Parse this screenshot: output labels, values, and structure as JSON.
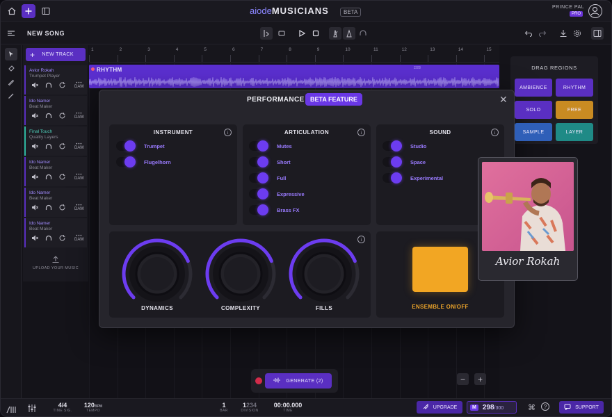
{
  "app": {
    "logo_mark": "aiode",
    "name": "MUSICIANS",
    "beta": "BETA"
  },
  "user": {
    "name": "PRINCE PAL",
    "plan": "PRO"
  },
  "song": {
    "title": "NEW SONG"
  },
  "tracks_panel": {
    "new_track_label": "NEW TRACK",
    "tracks": [
      {
        "name": "Avior Rokah",
        "role": "Trumpet Player"
      },
      {
        "name": "Ido Namer",
        "role": "Beat Maker"
      },
      {
        "name": "Final Touch",
        "role": "Quality Layers"
      },
      {
        "name": "Ido Namer",
        "role": "Beat Maker"
      },
      {
        "name": "Ido Namer",
        "role": "Beat Maker"
      },
      {
        "name": "Ido Namer",
        "role": "Beat Maker"
      }
    ],
    "daw_label": "DAW",
    "upload_label": "UPLOAD YOUR MUSIC"
  },
  "timeline": {
    "bars": [
      "1",
      "2",
      "3",
      "4",
      "5",
      "6",
      "7",
      "8",
      "9",
      "10",
      "11",
      "12",
      "13",
      "14",
      "15"
    ],
    "region_label": "RHYTHM",
    "region_marker": "2/28"
  },
  "drag_regions": {
    "title": "DRAG REGIONS",
    "items": [
      {
        "label": "AMBIENCE",
        "color": "#5a2fc2"
      },
      {
        "label": "RHYTHM",
        "color": "#5a2fc2"
      },
      {
        "label": "SOLO",
        "color": "#5a2fc2"
      },
      {
        "label": "FREE",
        "color": "#c98b22"
      },
      {
        "label": "SAMPLE",
        "color": "#2f5fb8"
      },
      {
        "label": "LAYER",
        "color": "#1f8a86"
      }
    ]
  },
  "modal": {
    "title": "PERFORMANCE",
    "badge": "BETA FEATURE",
    "instrument": {
      "title": "INSTRUMENT",
      "options": [
        "Trumpet",
        "Flugelhorn"
      ]
    },
    "articulation": {
      "title": "ARTICULATION",
      "options": [
        "Mutes",
        "Short",
        "Full",
        "Expressive",
        "Brass FX"
      ]
    },
    "sound": {
      "title": "SOUND",
      "options": [
        "Studio",
        "Space",
        "Experimental"
      ]
    },
    "knobs": [
      {
        "label": "DYNAMICS",
        "level": 0.75
      },
      {
        "label": "COMPLEXITY",
        "level": 0.75
      },
      {
        "label": "FILLS",
        "level": 0.75
      }
    ],
    "ensemble_label": "ENSEMBLE ON/OFF"
  },
  "artist_card": {
    "signature": "Avior Rokah"
  },
  "generate": {
    "label": "GENERATE (2)"
  },
  "bottom": {
    "time_sig": "4/4",
    "time_sig_label": "TIME SIG.",
    "tempo": "120",
    "tempo_unit": "BPM",
    "tempo_label": "TEMPO",
    "bar": "1",
    "bar_label": "BAR",
    "division": "1",
    "division_rest": "234",
    "division_label": "DIVISION",
    "time": "00:00.000",
    "time_label": "TIME",
    "upgrade_label": "UPGRADE",
    "credits_badge": "M",
    "credits_used": "298",
    "credits_total": "/300",
    "support_label": "SUPPORT"
  }
}
